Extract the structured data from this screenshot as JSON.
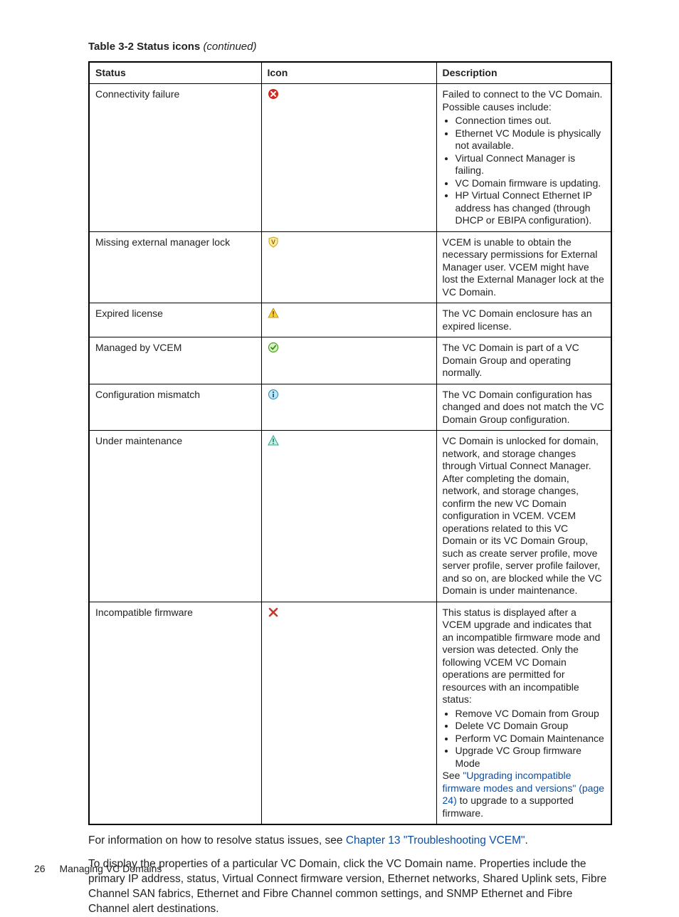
{
  "table_caption_prefix": "Table 3-2 Status icons",
  "table_caption_suffix": "(continued)",
  "columns": {
    "status": "Status",
    "icon": "Icon",
    "description": "Description"
  },
  "rows": {
    "r0": {
      "status": "Connectivity failure",
      "desc_intro": "Failed to connect to the VC Domain. Possible causes include:",
      "b0": "Connection times out.",
      "b1": "Ethernet VC Module is physically not available.",
      "b2": "Virtual Connect Manager is failing.",
      "b3": "VC Domain firmware is updating.",
      "b4": "HP Virtual Connect Ethernet IP address has changed (through DHCP or EBIPA configuration)."
    },
    "r1": {
      "status": "Missing external manager lock",
      "desc": "VCEM is unable to obtain the necessary permissions for External Manager user. VCEM might have lost the External Manager lock at the VC Domain."
    },
    "r2": {
      "status": "Expired license",
      "desc": "The VC Domain enclosure has an expired license."
    },
    "r3": {
      "status": "Managed by VCEM",
      "desc": "The VC Domain is part of a VC Domain Group and operating normally."
    },
    "r4": {
      "status": "Configuration mismatch",
      "desc": "The VC Domain configuration has changed and does not match the VC Domain Group configuration."
    },
    "r5": {
      "status": "Under maintenance",
      "desc": "VC Domain is unlocked for domain, network, and storage changes through Virtual Connect Manager. After completing the domain, network, and storage changes, confirm the new VC Domain configuration in VCEM. VCEM operations related to this VC Domain or its VC Domain Group, such as create server profile, move server profile, server profile failover, and so on, are blocked while the VC Domain is under maintenance."
    },
    "r6": {
      "status": "Incompatible firmware",
      "desc_intro": "This status is displayed after a VCEM upgrade and indicates that an incompatible firmware mode and version was detected. Only the following VCEM VC Domain operations are permitted for resources with an incompatible status:",
      "b0": "Remove VC Domain from Group",
      "b1": "Delete VC Domain Group",
      "b2": "Perform VC Domain Maintenance",
      "b3": "Upgrade VC Group firmware Mode",
      "tail_pre": "See ",
      "tail_link": "\"Upgrading incompatible firmware modes and versions\" (page 24)",
      "tail_post": " to upgrade to a supported firmware."
    }
  },
  "para1_pre": "For information on how to resolve status issues, see ",
  "para1_link": "Chapter 13 \"Troubleshooting VCEM\"",
  "para1_post": ".",
  "para2": "To display the properties of a particular VC Domain, click the VC Domain name. Properties include the primary IP address, status, Virtual Connect firmware version, Ethernet networks, Shared Uplink sets, Fibre Channel SAN fabrics, Ethernet and Fibre Channel common settings, and SNMP Ethernet and Fibre Channel alert destinations.",
  "footer": {
    "page": "26",
    "section": "Managing VC Domains"
  }
}
